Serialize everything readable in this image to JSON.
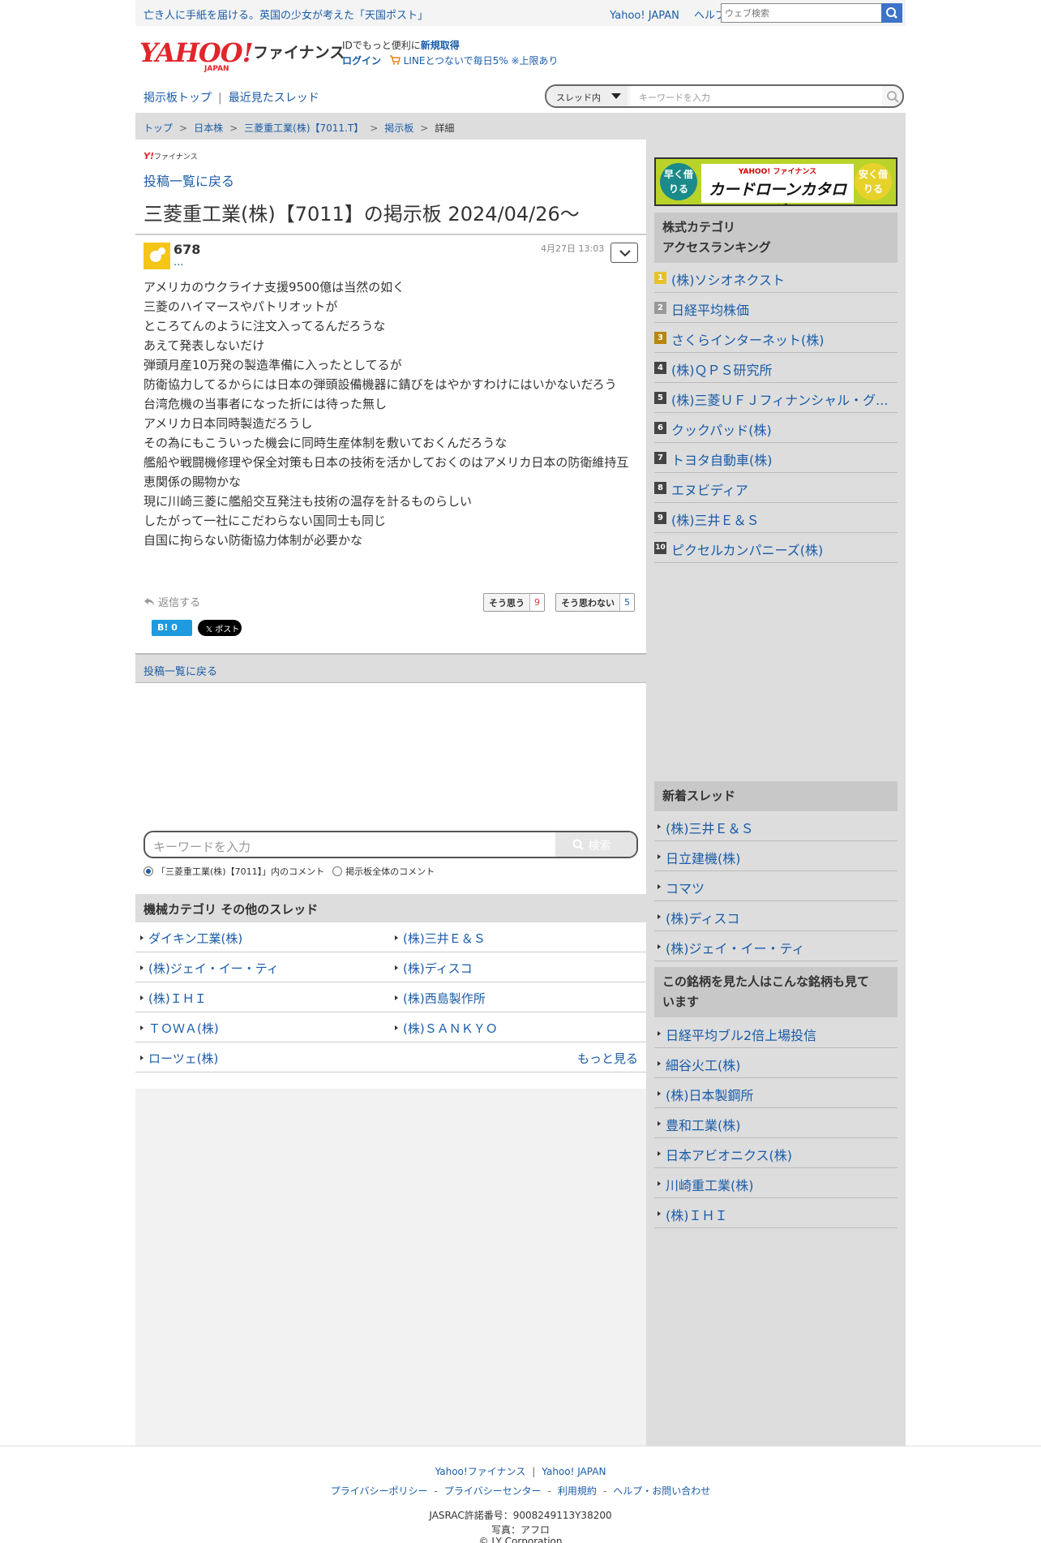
{
  "top": {
    "news": "亡き人に手紙を届ける。英国の少女が考えた「天国ポスト」",
    "links": [
      "Yahoo! JAPAN",
      "ヘルプ"
    ],
    "web_search_placeholder": "ウェブ検索"
  },
  "header": {
    "logo_main": "YAHOO!",
    "logo_sub": "JAPAN",
    "logo_service": "ファイナンス",
    "id_text": "IDでもっと便利に",
    "id_signup": "新規取得",
    "login": "ログイン",
    "line_promo": "LINEとつないで毎日5% ※上限あり"
  },
  "nav": {
    "board_top": "掲示板トップ",
    "recent": "最近見たスレッド",
    "scope": "スレッド内",
    "keyword_placeholder": "キーワードを入力"
  },
  "breadcrumb": [
    "トップ",
    "日本株",
    "三菱重工業(株)【7011.T】",
    "掲示板",
    "詳細"
  ],
  "main": {
    "small_logo_y": "Y!",
    "small_logo_text": "ファイナンス",
    "back_link": "投稿一覧に戻る",
    "title": "三菱重工業(株)【7011】の掲示板 2024/04/26〜",
    "post": {
      "number": "678",
      "user": "...",
      "date": "4月27日 13:03",
      "lines": [
        "アメリカのウクライナ支援9500億は当然の如く",
        "三菱のハイマースやパトリオットが",
        "ところてんのように注文入ってるんだろうな",
        "あえて発表しないだけ",
        "弾頭月産10万発の製造準備に入ったとしてるが",
        "防衛協力してるからには日本の弾頭設備機器に錆びをはやかすわけにはいかないだろう",
        "台湾危機の当事者になった折には待った無し",
        "アメリカ日本同時製造だろうし",
        "その為にもこういった機会に同時生産体制を敷いておくんだろうな",
        "艦船や戦闘機修理や保全対策も日本の技術を活かしておくのはアメリカ日本の防衛維持互恵関係の賜物かな",
        "現に川崎三菱に艦船交互発注も技術の温存を計るものらしい",
        "したがって一社にこだわらない国同士も同じ",
        "自国に拘らない防衛協力体制が必要かな"
      ],
      "reply": "返信する",
      "agree_label": "そう思う",
      "agree_count": "9",
      "disagree_label": "そう思わない",
      "disagree_count": "5",
      "hatena": "B! 0",
      "x_label": "𝕏 ポスト"
    },
    "back_link_bottom": "投稿一覧に戻る",
    "search": {
      "placeholder": "キーワードを入力",
      "button": "検索",
      "radio_in_thread": "「三菱重工業(株)【7011】」内のコメント",
      "radio_all": "掲示板全体のコメント"
    },
    "category": {
      "heading": "機械カテゴリ  その他のスレッド",
      "rows": [
        [
          "ダイキン工業(株)",
          "(株)三井Ｅ＆Ｓ"
        ],
        [
          "(株)ジェイ・イー・ティ",
          "(株)ディスコ"
        ],
        [
          "(株)ＩＨＩ",
          "(株)西島製作所"
        ],
        [
          "ＴＯＷＡ(株)",
          "(株)ＳＡＮＫＹＯ"
        ]
      ],
      "last": "ローツェ(株)",
      "more": "もっと見る"
    }
  },
  "sidebar": {
    "banner": {
      "left": "早く借りる",
      "small": "YAHOO! ファイナンス",
      "title": "カードローンカタログ",
      "right": "安く借りる"
    },
    "ranking_title_1": "株式カテゴリ",
    "ranking_title_2": "アクセスランキング",
    "ranking": [
      {
        "n": "1",
        "name": "(株)ソシオネクスト",
        "color": "#e6c229"
      },
      {
        "n": "2",
        "name": "日経平均株価",
        "color": "#999999"
      },
      {
        "n": "3",
        "name": "さくらインターネット(株)",
        "color": "#b8860b"
      },
      {
        "n": "4",
        "name": "(株)ＱＰＳ研究所",
        "color": "#444444"
      },
      {
        "n": "5",
        "name": "(株)三菱ＵＦＪフィナンシャル・グ...",
        "color": "#444444"
      },
      {
        "n": "6",
        "name": "クックパッド(株)",
        "color": "#444444"
      },
      {
        "n": "7",
        "name": "トヨタ自動車(株)",
        "color": "#444444"
      },
      {
        "n": "8",
        "name": "エヌビディア",
        "color": "#444444"
      },
      {
        "n": "9",
        "name": "(株)三井Ｅ＆Ｓ",
        "color": "#444444"
      },
      {
        "n": "10",
        "name": "ピクセルカンパニーズ(株)",
        "color": "#444444"
      }
    ],
    "new_threads_title": "新着スレッド",
    "new_threads": [
      "(株)三井Ｅ＆Ｓ",
      "日立建機(株)",
      "コマツ",
      "(株)ディスコ",
      "(株)ジェイ・イー・ティ"
    ],
    "also_viewed_title_1": "この銘柄を見た人はこんな銘柄も見て",
    "also_viewed_title_2": "います",
    "also_viewed": [
      "日経平均ブル2倍上場投信",
      "細谷火工(株)",
      "(株)日本製鋼所",
      "豊和工業(株)",
      "日本アビオニクス(株)",
      "川崎重工業(株)",
      "(株)ＩＨＩ"
    ]
  },
  "footer": {
    "links1": [
      "Yahoo!ファイナンス",
      "Yahoo! JAPAN"
    ],
    "links2": [
      "プライバシーポリシー",
      "プライバシーセンター",
      "利用規約",
      "ヘルプ・お問い合わせ"
    ],
    "jasrac": "JASRAC許諾番号：9008249113Y38200",
    "photo": "写真：アフロ",
    "copyright": "© LY Corporation"
  },
  "colors": {
    "link": "#1a5ca8",
    "logo_red": "#e0262b",
    "sidebar_bg": "#dddddd",
    "search_blue": "#3d73c7"
  }
}
